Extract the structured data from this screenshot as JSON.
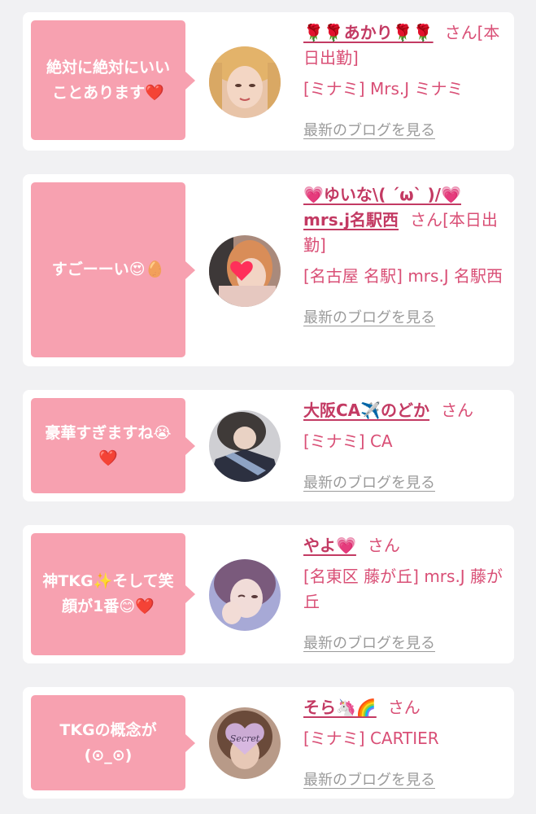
{
  "entries": [
    {
      "comment": "絶対に絶対にいいことあります❤️",
      "name": "🌹🌹あかり🌹🌹",
      "honorific": "さん",
      "status": "[本日出勤]",
      "shop": "[ミナミ] Mrs.J ミナミ",
      "blog_link": "最新のブログを見る",
      "avatar_icon": "girl-photo"
    },
    {
      "comment": "すごーーい😍🥚",
      "name": "💗ゆいな\\( ´ω` )/💗 mrs.j名駅西",
      "honorific": "さん",
      "status": "[本日出勤]",
      "shop": "[名古屋 名駅] mrs.J 名駅西",
      "blog_link": "最新のブログを見る",
      "avatar_icon": "girl-photo-heart-sticker"
    },
    {
      "comment": "豪華すぎますね😭❤️",
      "name": "大阪CA✈️のどか",
      "honorific": "さん",
      "status": "",
      "shop": "[ミナミ] CA",
      "blog_link": "最新のブログを見る",
      "avatar_icon": "girl-photo"
    },
    {
      "comment": "神TKG✨そして笑顔が1番😊❤️",
      "name": "やよ💗",
      "honorific": "さん",
      "status": "",
      "shop": "[名東区 藤が丘] mrs.J 藤が丘",
      "blog_link": "最新のブログを見る",
      "avatar_icon": "girl-photo"
    },
    {
      "comment": "TKGの概念が(⊙_⊙)",
      "name": "そら🦄🌈",
      "honorific": "さん",
      "status": "",
      "shop": "[ミナミ] CARTIER",
      "blog_link": "最新のブログを見る",
      "avatar_icon": "girl-photo-secret-sticker",
      "avatar_sticker_text": "Secret"
    }
  ],
  "colors": {
    "bubble": "#f7a1b0",
    "name": "#c33a63",
    "text": "#d94f76",
    "link": "#9a9a9a",
    "background": "#f1f1f3"
  }
}
